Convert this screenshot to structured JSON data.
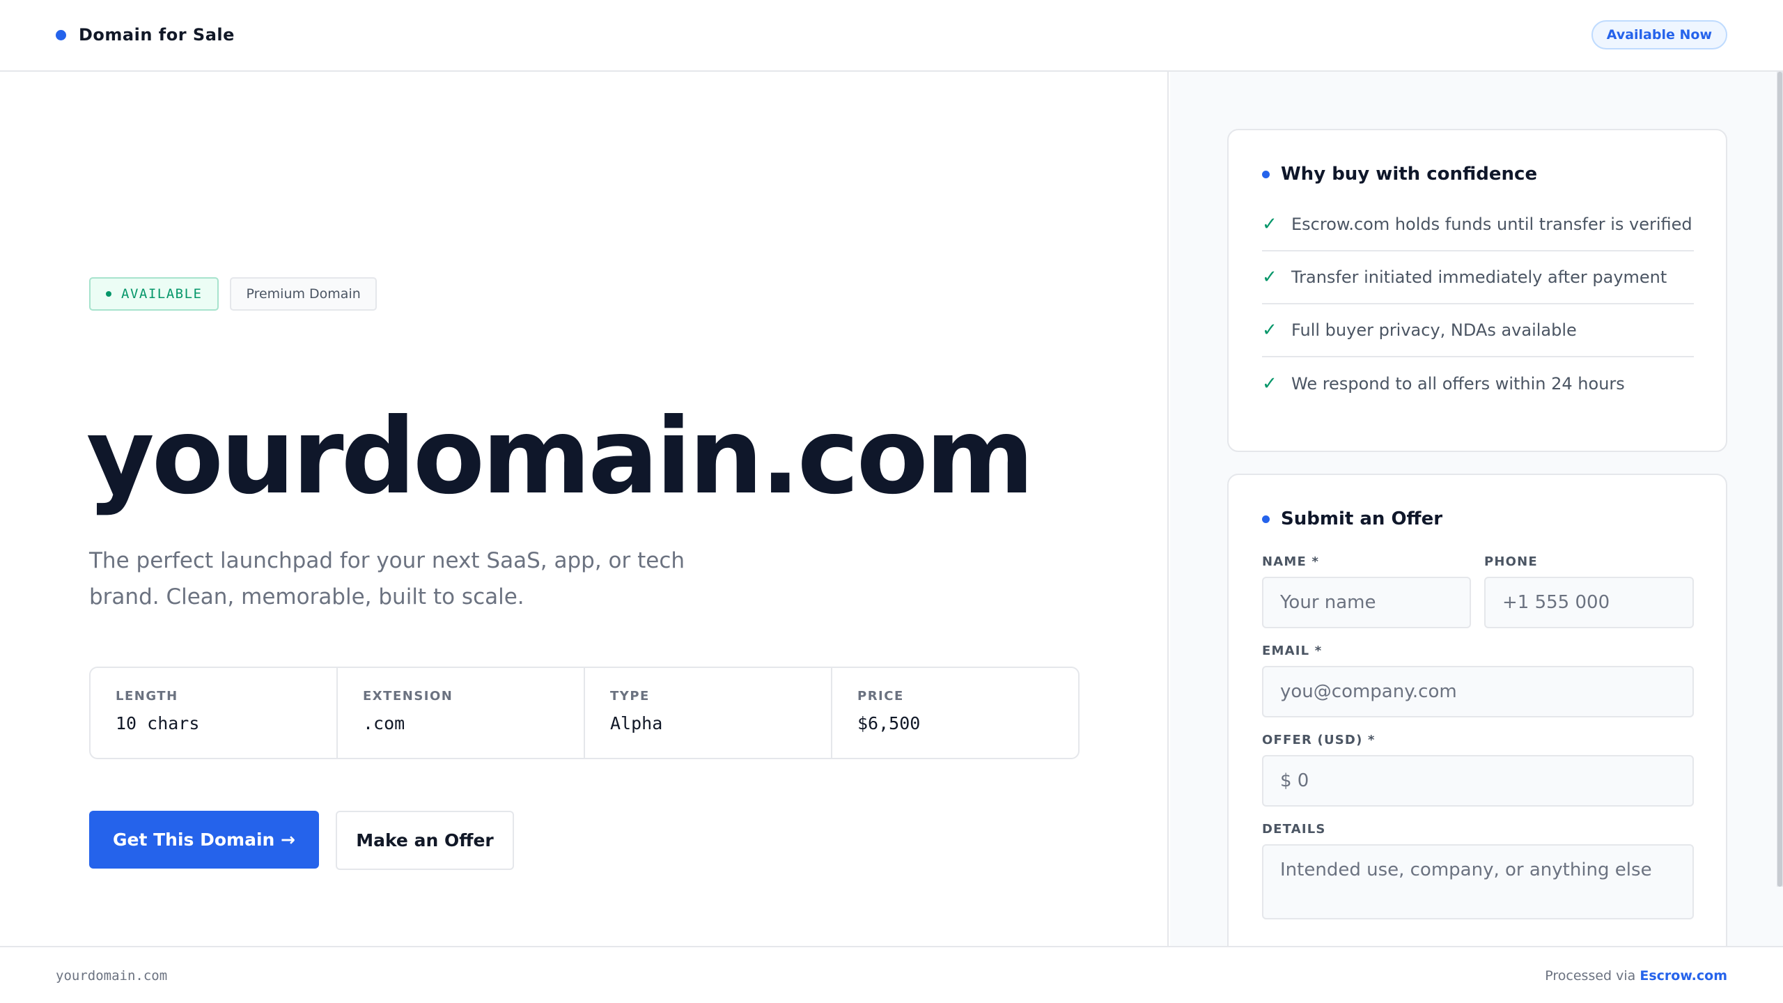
{
  "header": {
    "brand_label": "Domain for Sale",
    "status_pill": "Available Now"
  },
  "hero": {
    "badge_available": "AVAILABLE",
    "badge_premium": "Premium Domain",
    "domain": "yourdomain.com",
    "tagline": "The perfect launchpad for your next SaaS, app, or tech brand. Clean, memorable, built to scale."
  },
  "specs": [
    {
      "label": "LENGTH",
      "value": "10 chars"
    },
    {
      "label": "EXTENSION",
      "value": ".com"
    },
    {
      "label": "TYPE",
      "value": "Alpha"
    },
    {
      "label": "PRICE",
      "value": "$6,500"
    }
  ],
  "actions": {
    "primary_label": "Get This Domain →",
    "secondary_label": "Make an Offer"
  },
  "why": {
    "title": "Why buy with confidence",
    "items": [
      "Escrow.com holds funds until transfer is verified",
      "Transfer initiated immediately after payment",
      "Full buyer privacy, NDAs available",
      "We respond to all offers within 24 hours"
    ]
  },
  "offer_form": {
    "title": "Submit an Offer",
    "name_label": "NAME *",
    "name_placeholder": "Your name",
    "phone_label": "PHONE",
    "phone_placeholder": "+1 555 000",
    "email_label": "EMAIL *",
    "email_placeholder": "you@company.com",
    "offer_label": "OFFER (USD) *",
    "offer_placeholder": "$ 0",
    "details_label": "DETAILS",
    "details_placeholder": "Intended use, company, or anything else"
  },
  "footer": {
    "domain": "yourdomain.com",
    "processed_prefix": "Processed via",
    "processed_link": "Escrow.com"
  },
  "colors": {
    "accent": "#2563eb",
    "success": "#059669",
    "text_dark": "#0f172a",
    "text_muted": "#6b7280",
    "border": "#e5e7eb"
  },
  "icons": {
    "check": "check-icon",
    "arrow": "arrow-right-icon"
  }
}
